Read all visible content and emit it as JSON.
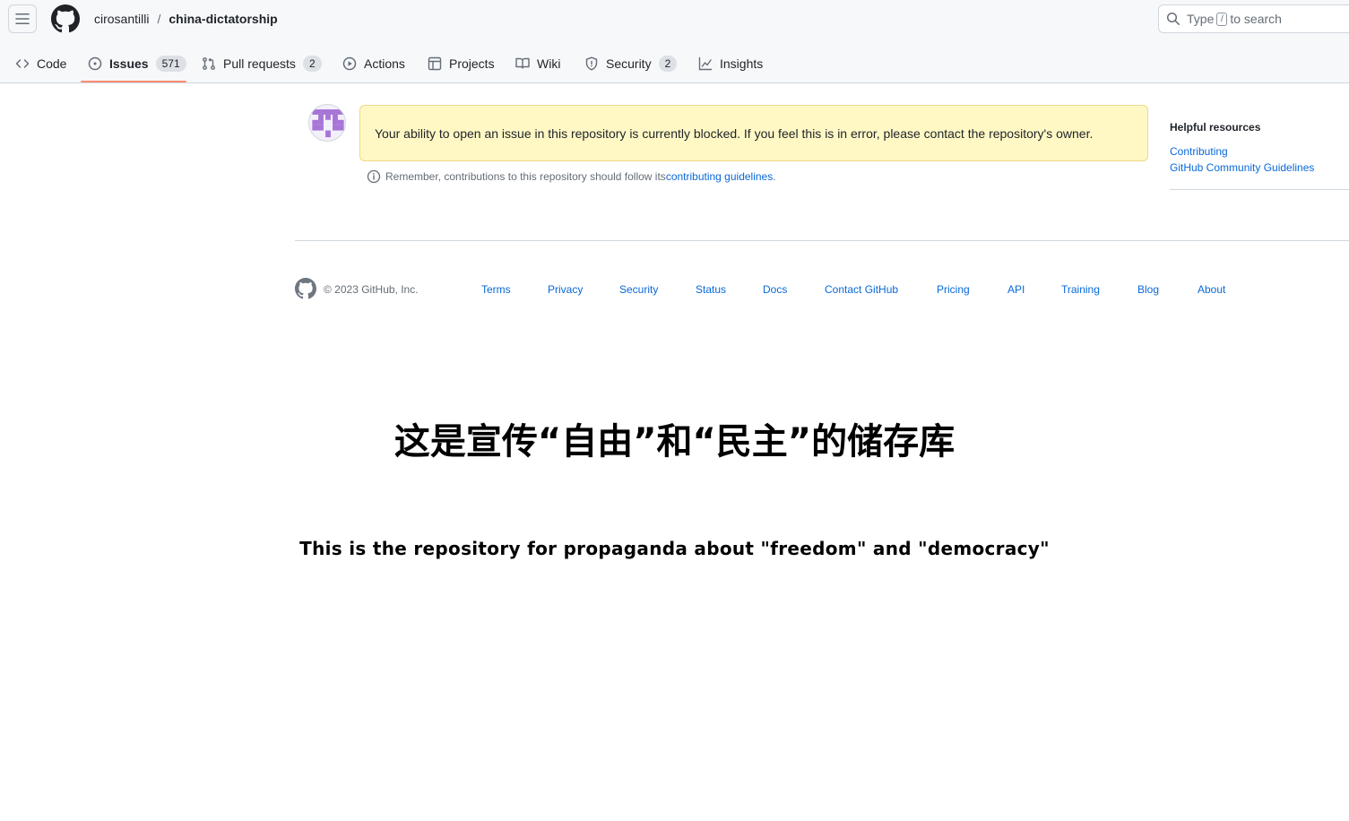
{
  "header": {
    "owner": "cirosantilli",
    "separator": "/",
    "repo": "china-dictatorship",
    "search": {
      "prefix": "Type",
      "key": "/",
      "suffix": "to search"
    }
  },
  "tabs": [
    {
      "label": "Code",
      "icon": "code-icon"
    },
    {
      "label": "Issues",
      "icon": "issue-opened-icon",
      "count": "571",
      "selected": true
    },
    {
      "label": "Pull requests",
      "icon": "git-pull-request-icon",
      "count": "2"
    },
    {
      "label": "Actions",
      "icon": "play-icon"
    },
    {
      "label": "Projects",
      "icon": "table-icon"
    },
    {
      "label": "Wiki",
      "icon": "book-icon"
    },
    {
      "label": "Security",
      "icon": "shield-icon",
      "count": "2"
    },
    {
      "label": "Insights",
      "icon": "graph-icon"
    }
  ],
  "flash": {
    "message": "Your ability to open an issue in this repository is currently blocked. If you feel this is in error, please contact the repository's owner."
  },
  "note": {
    "text": "Remember, contributions to this repository should follow its ",
    "link": "contributing guidelines",
    "end": "."
  },
  "resources": {
    "title": "Helpful resources",
    "links": [
      "Contributing",
      "GitHub Community Guidelines"
    ]
  },
  "footer": {
    "copyright": "© 2023 GitHub, Inc.",
    "links": [
      "Terms",
      "Privacy",
      "Security",
      "Status",
      "Docs",
      "Contact GitHub",
      "Pricing",
      "API",
      "Training",
      "Blog",
      "About"
    ]
  },
  "captions": {
    "chinese": "这是宣传“自由”和“民主”的储存库",
    "english": "This is the repository for propaganda about \"freedom\" and \"democracy\""
  },
  "colors": {
    "accent_underline": "#fd8c73",
    "link": "#0969da",
    "flash_bg": "#fff8c5",
    "avatar": "#a775d6"
  }
}
